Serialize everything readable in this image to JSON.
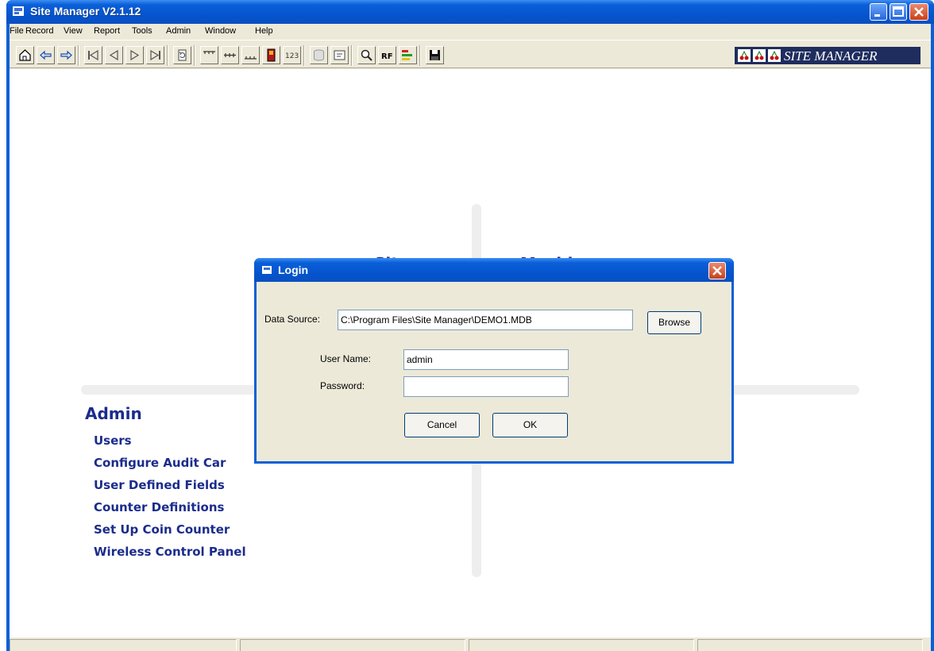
{
  "window": {
    "title": "Site Manager  V2.1.12"
  },
  "menu": [
    {
      "label": "File"
    },
    {
      "label": "Record"
    },
    {
      "label": "View"
    },
    {
      "label": "Report"
    },
    {
      "label": "Tools"
    },
    {
      "label": "Admin"
    },
    {
      "label": "Window"
    },
    {
      "label": "Help"
    }
  ],
  "toolbar": {
    "rf_label": "RF",
    "count_label": "123",
    "brand_text": "SITE MANAGER"
  },
  "background": {
    "sites_label": "Sites",
    "machines_label": "Machines",
    "admin_heading": "Admin",
    "admin_links": [
      "Users",
      "Configure Audit Car",
      "User Defined Fields",
      "Counter Definitions",
      "Set Up Coin Counter",
      "Wireless Control Panel"
    ]
  },
  "login": {
    "title": "Login",
    "data_source_label": "Data Source:",
    "data_source_value": "C:\\Program Files\\Site Manager\\DEMO1.MDB",
    "browse_label": "Browse",
    "username_label": "User Name:",
    "username_value": "admin",
    "password_label": "Password:",
    "password_value": "",
    "cancel_label": "Cancel",
    "ok_label": "OK"
  },
  "colors": {
    "titlebar": "#0a5fd8",
    "link": "#1b2c8c",
    "brand_bg": "#1f2d5e"
  }
}
